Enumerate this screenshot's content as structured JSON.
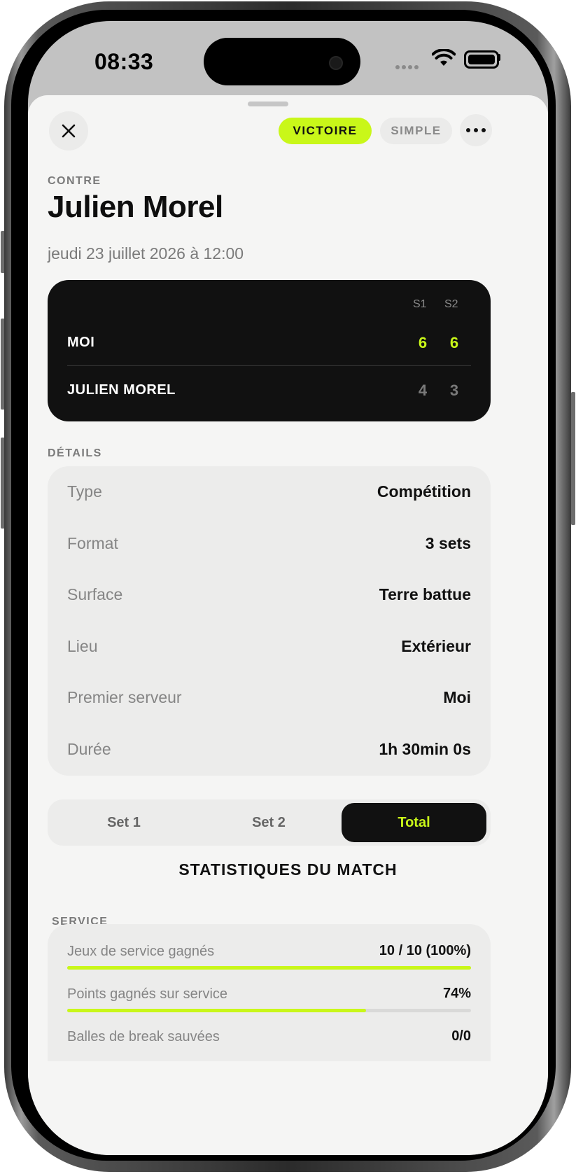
{
  "status_bar": {
    "time": "08:33"
  },
  "header": {
    "result_badge": "VICTOIRE",
    "type_badge": "SIMPLE"
  },
  "match": {
    "eyebrow": "CONTRE",
    "opponent": "Julien Morel",
    "date": "jeudi 23 juillet 2026 à 12:00"
  },
  "scoreboard": {
    "set_headers": [
      "S1",
      "S2"
    ],
    "players": [
      {
        "name": "MOI",
        "scores": [
          "6",
          "6"
        ],
        "winner": true
      },
      {
        "name": "JULIEN MOREL",
        "scores": [
          "4",
          "3"
        ],
        "winner": false
      }
    ]
  },
  "details": {
    "section_label": "DÉTAILS",
    "rows": [
      {
        "label": "Type",
        "value": "Compétition"
      },
      {
        "label": "Format",
        "value": "3 sets"
      },
      {
        "label": "Surface",
        "value": "Terre battue"
      },
      {
        "label": "Lieu",
        "value": "Extérieur"
      },
      {
        "label": "Premier serveur",
        "value": "Moi"
      },
      {
        "label": "Durée",
        "value": "1h 30min 0s"
      }
    ]
  },
  "tabs": {
    "items": [
      "Set 1",
      "Set 2",
      "Total"
    ],
    "active_index": 2
  },
  "stats": {
    "title": "STATISTIQUES DU MATCH",
    "service_label": "SERVICE",
    "rows": [
      {
        "label": "Jeux de service gagnés",
        "value": "10 / 10 (100%)",
        "progress": 1.0
      },
      {
        "label": "Points gagnés sur service",
        "value": "74%",
        "progress": 0.74
      },
      {
        "label": "Balles de break sauvées",
        "value": "0/0",
        "progress": null
      }
    ]
  },
  "colors": {
    "accent": "#c9f719",
    "dark": "#111111",
    "background": "#f5f5f4"
  }
}
